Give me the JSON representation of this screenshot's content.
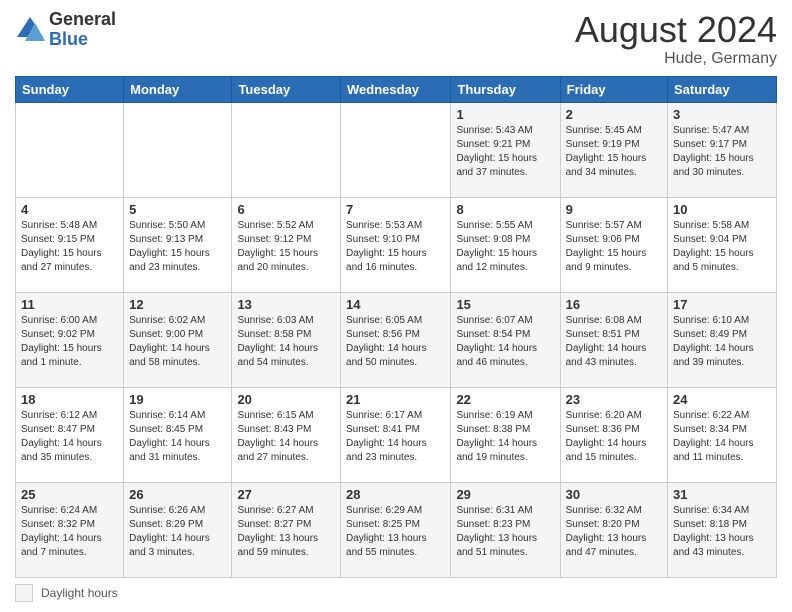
{
  "logo": {
    "general": "General",
    "blue": "Blue"
  },
  "title": "August 2024",
  "subtitle": "Hude, Germany",
  "weekdays": [
    "Sunday",
    "Monday",
    "Tuesday",
    "Wednesday",
    "Thursday",
    "Friday",
    "Saturday"
  ],
  "footer_label": "Daylight hours",
  "weeks": [
    [
      {
        "day": "",
        "info": ""
      },
      {
        "day": "",
        "info": ""
      },
      {
        "day": "",
        "info": ""
      },
      {
        "day": "",
        "info": ""
      },
      {
        "day": "1",
        "info": "Sunrise: 5:43 AM\nSunset: 9:21 PM\nDaylight: 15 hours\nand 37 minutes."
      },
      {
        "day": "2",
        "info": "Sunrise: 5:45 AM\nSunset: 9:19 PM\nDaylight: 15 hours\nand 34 minutes."
      },
      {
        "day": "3",
        "info": "Sunrise: 5:47 AM\nSunset: 9:17 PM\nDaylight: 15 hours\nand 30 minutes."
      }
    ],
    [
      {
        "day": "4",
        "info": "Sunrise: 5:48 AM\nSunset: 9:15 PM\nDaylight: 15 hours\nand 27 minutes."
      },
      {
        "day": "5",
        "info": "Sunrise: 5:50 AM\nSunset: 9:13 PM\nDaylight: 15 hours\nand 23 minutes."
      },
      {
        "day": "6",
        "info": "Sunrise: 5:52 AM\nSunset: 9:12 PM\nDaylight: 15 hours\nand 20 minutes."
      },
      {
        "day": "7",
        "info": "Sunrise: 5:53 AM\nSunset: 9:10 PM\nDaylight: 15 hours\nand 16 minutes."
      },
      {
        "day": "8",
        "info": "Sunrise: 5:55 AM\nSunset: 9:08 PM\nDaylight: 15 hours\nand 12 minutes."
      },
      {
        "day": "9",
        "info": "Sunrise: 5:57 AM\nSunset: 9:06 PM\nDaylight: 15 hours\nand 9 minutes."
      },
      {
        "day": "10",
        "info": "Sunrise: 5:58 AM\nSunset: 9:04 PM\nDaylight: 15 hours\nand 5 minutes."
      }
    ],
    [
      {
        "day": "11",
        "info": "Sunrise: 6:00 AM\nSunset: 9:02 PM\nDaylight: 15 hours\nand 1 minute."
      },
      {
        "day": "12",
        "info": "Sunrise: 6:02 AM\nSunset: 9:00 PM\nDaylight: 14 hours\nand 58 minutes."
      },
      {
        "day": "13",
        "info": "Sunrise: 6:03 AM\nSunset: 8:58 PM\nDaylight: 14 hours\nand 54 minutes."
      },
      {
        "day": "14",
        "info": "Sunrise: 6:05 AM\nSunset: 8:56 PM\nDaylight: 14 hours\nand 50 minutes."
      },
      {
        "day": "15",
        "info": "Sunrise: 6:07 AM\nSunset: 8:54 PM\nDaylight: 14 hours\nand 46 minutes."
      },
      {
        "day": "16",
        "info": "Sunrise: 6:08 AM\nSunset: 8:51 PM\nDaylight: 14 hours\nand 43 minutes."
      },
      {
        "day": "17",
        "info": "Sunrise: 6:10 AM\nSunset: 8:49 PM\nDaylight: 14 hours\nand 39 minutes."
      }
    ],
    [
      {
        "day": "18",
        "info": "Sunrise: 6:12 AM\nSunset: 8:47 PM\nDaylight: 14 hours\nand 35 minutes."
      },
      {
        "day": "19",
        "info": "Sunrise: 6:14 AM\nSunset: 8:45 PM\nDaylight: 14 hours\nand 31 minutes."
      },
      {
        "day": "20",
        "info": "Sunrise: 6:15 AM\nSunset: 8:43 PM\nDaylight: 14 hours\nand 27 minutes."
      },
      {
        "day": "21",
        "info": "Sunrise: 6:17 AM\nSunset: 8:41 PM\nDaylight: 14 hours\nand 23 minutes."
      },
      {
        "day": "22",
        "info": "Sunrise: 6:19 AM\nSunset: 8:38 PM\nDaylight: 14 hours\nand 19 minutes."
      },
      {
        "day": "23",
        "info": "Sunrise: 6:20 AM\nSunset: 8:36 PM\nDaylight: 14 hours\nand 15 minutes."
      },
      {
        "day": "24",
        "info": "Sunrise: 6:22 AM\nSunset: 8:34 PM\nDaylight: 14 hours\nand 11 minutes."
      }
    ],
    [
      {
        "day": "25",
        "info": "Sunrise: 6:24 AM\nSunset: 8:32 PM\nDaylight: 14 hours\nand 7 minutes."
      },
      {
        "day": "26",
        "info": "Sunrise: 6:26 AM\nSunset: 8:29 PM\nDaylight: 14 hours\nand 3 minutes."
      },
      {
        "day": "27",
        "info": "Sunrise: 6:27 AM\nSunset: 8:27 PM\nDaylight: 13 hours\nand 59 minutes."
      },
      {
        "day": "28",
        "info": "Sunrise: 6:29 AM\nSunset: 8:25 PM\nDaylight: 13 hours\nand 55 minutes."
      },
      {
        "day": "29",
        "info": "Sunrise: 6:31 AM\nSunset: 8:23 PM\nDaylight: 13 hours\nand 51 minutes."
      },
      {
        "day": "30",
        "info": "Sunrise: 6:32 AM\nSunset: 8:20 PM\nDaylight: 13 hours\nand 47 minutes."
      },
      {
        "day": "31",
        "info": "Sunrise: 6:34 AM\nSunset: 8:18 PM\nDaylight: 13 hours\nand 43 minutes."
      }
    ]
  ]
}
